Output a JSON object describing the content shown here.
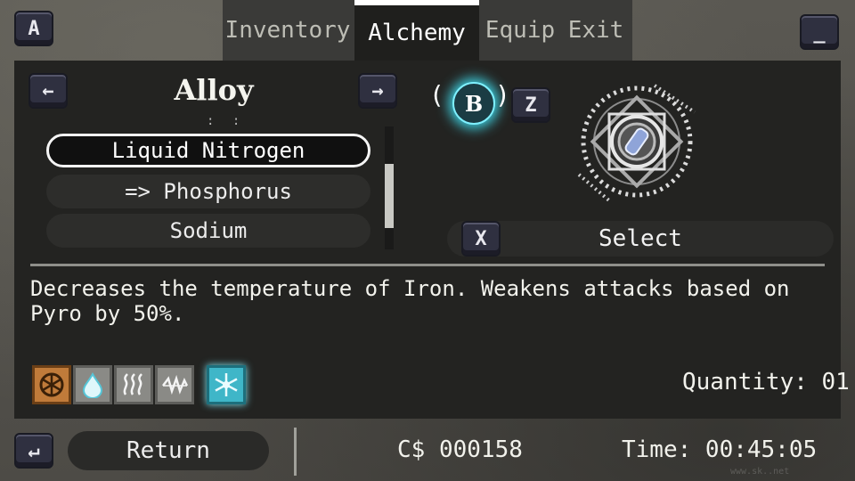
{
  "keys": {
    "top_left": "A",
    "top_right": "_",
    "prev": "←",
    "next": "→",
    "swap_left": "(",
    "swap_right": ")",
    "b": "B",
    "z": "Z",
    "x": "X",
    "return": "↵"
  },
  "tabs": [
    {
      "label": "Inventory",
      "active": false
    },
    {
      "label": "Alchemy",
      "active": true
    },
    {
      "label": "Equip",
      "active": false
    },
    {
      "label": "Exit",
      "active": false
    }
  ],
  "category": {
    "title": "Alloy",
    "more_above": ": :"
  },
  "items": [
    {
      "label": "Liquid Nitrogen",
      "selected": true
    },
    {
      "label": "=> Phosphorus",
      "selected": false
    },
    {
      "label": "Sodium",
      "selected": false
    }
  ],
  "scroll": {
    "position": 0.35
  },
  "action": {
    "select_label": "Select"
  },
  "description": "Decreases the temperature of Iron. Weakens attacks based on Pyro by 50%.",
  "elements": [
    {
      "icon": "ward-icon",
      "color": "#c07b3a"
    },
    {
      "icon": "water-drop-icon",
      "color": "#8a8a86"
    },
    {
      "icon": "steam-icon",
      "color": "#8a8a86"
    },
    {
      "icon": "wave-icon",
      "color": "#8a8a86"
    },
    {
      "icon": "snowflake-icon",
      "color": "#3fb6c8"
    }
  ],
  "quantity": "Quantity: 01",
  "footer": {
    "return_label": "Return",
    "money": "C$ 000158",
    "time": "Time: 00:45:05"
  },
  "watermark": "www.sk..net"
}
